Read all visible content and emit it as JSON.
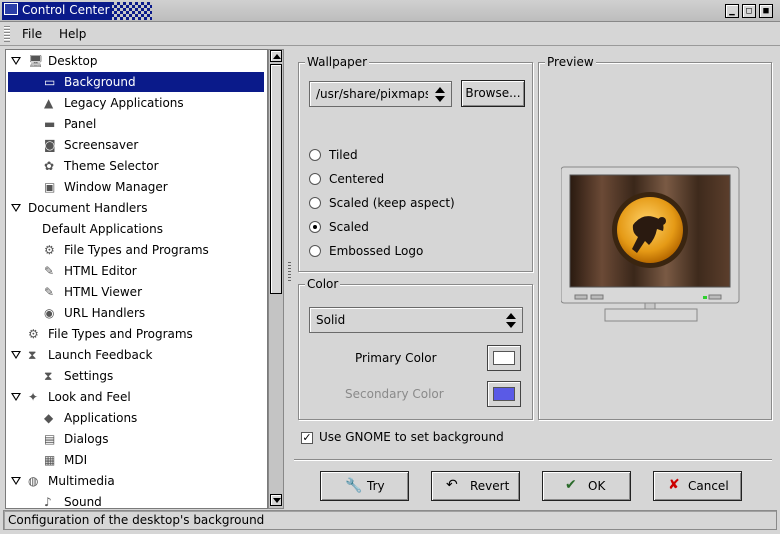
{
  "window": {
    "title": "Control Center"
  },
  "menu": {
    "file": "File",
    "help": "Help"
  },
  "tree": [
    {
      "label": "Desktop",
      "level": 0,
      "expanded": true,
      "icon": "desktop-icon"
    },
    {
      "label": "Background",
      "level": 1,
      "selected": true,
      "icon": "monitor-icon"
    },
    {
      "label": "Legacy Applications",
      "level": 1,
      "icon": "triangle-icon"
    },
    {
      "label": "Panel",
      "level": 1,
      "icon": "panel-icon"
    },
    {
      "label": "Screensaver",
      "level": 1,
      "icon": "screensaver-icon"
    },
    {
      "label": "Theme Selector",
      "level": 1,
      "icon": "theme-icon"
    },
    {
      "label": "Window Manager",
      "level": 1,
      "icon": "window-icon"
    },
    {
      "label": "Document Handlers",
      "level": 0,
      "expanded": true,
      "icon": ""
    },
    {
      "label": "Default Applications",
      "level": 1,
      "icon": ""
    },
    {
      "label": "File Types and Programs",
      "level": 1,
      "icon": "filetypes-icon"
    },
    {
      "label": "HTML Editor",
      "level": 1,
      "icon": "pen-icon"
    },
    {
      "label": "HTML Viewer",
      "level": 1,
      "icon": "pen-icon"
    },
    {
      "label": "URL Handlers",
      "level": 1,
      "icon": "globe-icon"
    },
    {
      "label": "File Types and Programs",
      "level": 0,
      "leaf": true,
      "icon": "filetypes-icon"
    },
    {
      "label": "Launch Feedback",
      "level": 0,
      "expanded": true,
      "icon": "hourglass-icon"
    },
    {
      "label": "Settings",
      "level": 1,
      "icon": "hourglass-icon"
    },
    {
      "label": "Look and Feel",
      "level": 0,
      "expanded": true,
      "icon": "lookfeel-icon"
    },
    {
      "label": "Applications",
      "level": 1,
      "icon": "app-icon"
    },
    {
      "label": "Dialogs",
      "level": 1,
      "icon": "dialog-icon"
    },
    {
      "label": "MDI",
      "level": 1,
      "icon": "mdi-icon"
    },
    {
      "label": "Multimedia",
      "level": 0,
      "expanded": true,
      "icon": "drum-icon"
    },
    {
      "label": "Sound",
      "level": 1,
      "icon": "sound-icon"
    }
  ],
  "wallpaper": {
    "frame_title": "Wallpaper",
    "path": "/usr/share/pixmaps/l",
    "browse_label": "Browse...",
    "options": [
      {
        "label": "Tiled",
        "checked": false
      },
      {
        "label": "Centered",
        "checked": false
      },
      {
        "label": "Scaled (keep aspect)",
        "checked": false
      },
      {
        "label": "Scaled",
        "checked": true
      },
      {
        "label": "Embossed Logo",
        "checked": false
      }
    ]
  },
  "color": {
    "frame_title": "Color",
    "mode": "Solid",
    "primary_label": "Primary Color",
    "primary_color": "#ffffff",
    "secondary_label": "Secondary Color",
    "secondary_color": "#5a5ae6"
  },
  "preview": {
    "frame_title": "Preview"
  },
  "use_gnome": {
    "label": "Use GNOME to set background",
    "checked": true
  },
  "buttons": {
    "try": "Try",
    "revert": "Revert",
    "ok": "OK",
    "cancel": "Cancel"
  },
  "status": "Configuration of the desktop's background",
  "colors": {
    "title_bg": "#0a1a8a",
    "selection": "#0a1a8a",
    "face": "#d6d6d6"
  }
}
